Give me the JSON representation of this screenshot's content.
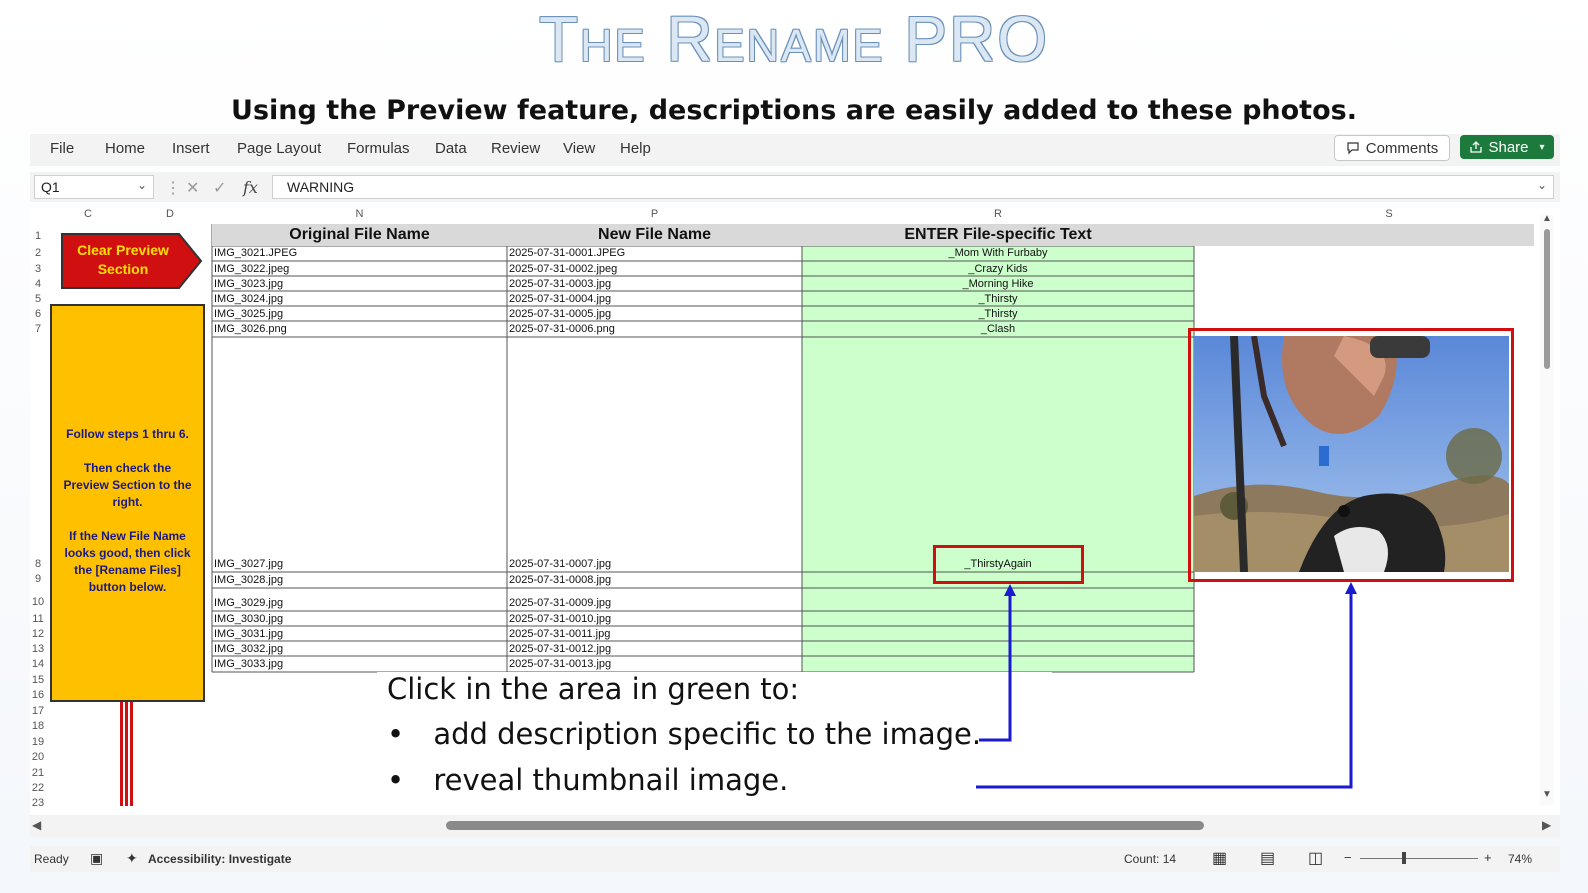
{
  "slide": {
    "title": "The Rename PRO",
    "subtitle": "Using the Preview feature, descriptions are easily added to these photos."
  },
  "ribbon": {
    "menu": [
      "File",
      "Home",
      "Insert",
      "Page Layout",
      "Formulas",
      "Data",
      "Review",
      "View",
      "Help"
    ],
    "comments_label": "Comments",
    "share_label": "Share"
  },
  "formula_bar": {
    "name_box": "Q1",
    "formula": "WARNING"
  },
  "columns": [
    "C",
    "D",
    "N",
    "P",
    "R",
    "S"
  ],
  "row_numbers": [
    "1",
    "2",
    "3",
    "4",
    "5",
    "6",
    "7",
    "8",
    "9",
    "10",
    "11",
    "12",
    "13",
    "14",
    "15",
    "16",
    "17",
    "18",
    "19",
    "20",
    "21",
    "22",
    "23"
  ],
  "table": {
    "headers": [
      "Original File Name",
      "New File Name",
      "ENTER File-specific Text"
    ],
    "rows": [
      {
        "original": "IMG_3021.JPEG",
        "new": "2025-07-31-0001.JPEG",
        "text": "_Mom With Furbaby"
      },
      {
        "original": "IMG_3022.jpeg",
        "new": "2025-07-31-0002.jpeg",
        "text": "_Crazy Kids"
      },
      {
        "original": "IMG_3023.jpg",
        "new": "2025-07-31-0003.jpg",
        "text": "_Morning Hike"
      },
      {
        "original": "IMG_3024.jpg",
        "new": "2025-07-31-0004.jpg",
        "text": "_Thirsty"
      },
      {
        "original": "IMG_3025.jpg",
        "new": "2025-07-31-0005.jpg",
        "text": "_Thirsty"
      },
      {
        "original": "IMG_3026.png",
        "new": "2025-07-31-0006.png",
        "text": "_Clash"
      },
      {
        "original": "IMG_3027.jpg",
        "new": "2025-07-31-0007.jpg",
        "text": "_ThirstyAgain"
      },
      {
        "original": "IMG_3028.jpg",
        "new": "2025-07-31-0008.jpg",
        "text": ""
      },
      {
        "original": "IMG_3029.jpg",
        "new": "2025-07-31-0009.jpg",
        "text": ""
      },
      {
        "original": "IMG_3030.jpg",
        "new": "2025-07-31-0010.jpg",
        "text": ""
      },
      {
        "original": "IMG_3031.jpg",
        "new": "2025-07-31-0011.jpg",
        "text": ""
      },
      {
        "original": "IMG_3032.jpg",
        "new": "2025-07-31-0012.jpg",
        "text": ""
      },
      {
        "original": "IMG_3033.jpg",
        "new": "2025-07-31-0013.jpg",
        "text": ""
      }
    ]
  },
  "clear_button": {
    "line1": "Clear Preview",
    "line2": "Section"
  },
  "instructions": {
    "p1": "Follow steps 1 thru 6.",
    "p2": "Then check the Preview Section to the right.",
    "p3": "If the New File Name looks good, then click the [Rename Files] button below."
  },
  "callout": {
    "heading": "Click in the area in green to:",
    "bullet1": "add description specific to the image.",
    "bullet2": "reveal thumbnail image."
  },
  "status": {
    "ready": "Ready",
    "accessibility": "Accessibility: Investigate",
    "count": "Count: 14",
    "zoom": "74%"
  },
  "colors": {
    "accent_green": "#1d7a3d",
    "cell_green": "#ccffcc",
    "highlight_red": "#d01010",
    "arrow_blue": "#1a1ad0",
    "yellow": "#ffc000"
  }
}
